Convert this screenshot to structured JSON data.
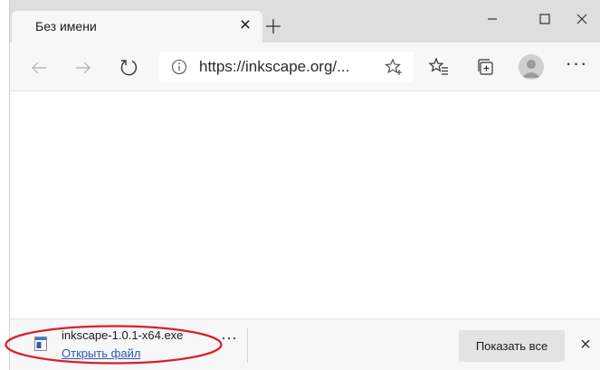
{
  "tab": {
    "title": "Без имени",
    "close_glyph": "×"
  },
  "toolbar": {
    "url": "https://inkscape.org/...",
    "icons": [
      "back-arrow-icon",
      "forward-arrow-icon",
      "refresh-icon",
      "info-icon",
      "add-favorite-star-icon",
      "favorites-icon",
      "collections-icon",
      "profile-avatar-icon"
    ],
    "more_glyph": "···"
  },
  "download": {
    "file_name": "inkscape-1.0.1-x64.exe",
    "open_label": "Открыть файл",
    "more_glyph": "···",
    "show_all_label": "Показать все",
    "close_glyph": "×"
  },
  "colors": {
    "highlight": "#d8202a",
    "link": "#2a5ab7",
    "tabstrip": "#dedede",
    "toolbar": "#f7f7f7"
  }
}
